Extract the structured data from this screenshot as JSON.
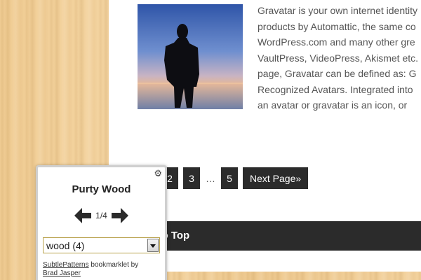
{
  "article": {
    "lines": [
      "Gravatar is your own internet identity",
      "products by Automattic, the same co",
      "WordPress.com and many other gre",
      "VaultPress, VideoPress, Akismet etc.",
      "page, Gravatar can be defined as: G",
      "Recognized Avatars. Integrated into",
      "an avatar or gravatar is an icon, or"
    ]
  },
  "pagination": {
    "pages": [
      "2",
      "3"
    ],
    "ellipsis": "…",
    "last_page": "5",
    "next_label": "Next Page»"
  },
  "footer": {
    "back_to_top": "k to Top"
  },
  "bookmarklet": {
    "title": "Purty Wood",
    "counter": "1/4",
    "select_value": "wood (4)",
    "credit_link1": "SubtlePatterns",
    "credit_text": " bookmarklet by",
    "credit_link2": "Brad Jasper",
    "gear_icon": "gear-icon"
  },
  "colors": {
    "dark_button": "#2b2b2b",
    "select_border": "#b8a14a",
    "wood": "#f0cc93"
  }
}
